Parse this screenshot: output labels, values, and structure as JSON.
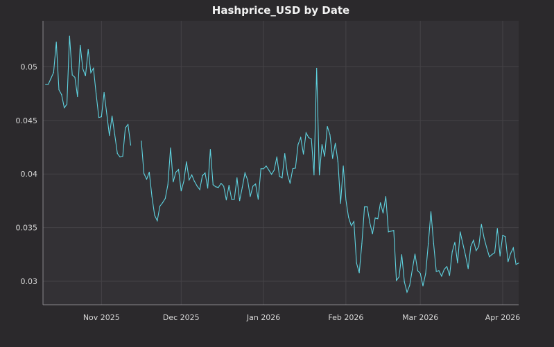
{
  "chart_data": {
    "type": "line",
    "title": "Hashprice_USD by Date",
    "xlabel": "",
    "ylabel": "",
    "xlim": [
      "2025-10-10",
      "2026-04-07"
    ],
    "ylim": [
      0.0278,
      0.0543
    ],
    "grid": true,
    "line_color": "#5fd3e0",
    "x_ticks": [
      {
        "date": "2025-11-01",
        "label": "Nov 2025"
      },
      {
        "date": "2025-12-01",
        "label": "Dec 2025"
      },
      {
        "date": "2026-01-01",
        "label": "Jan 2026"
      },
      {
        "date": "2026-02-01",
        "label": "Feb 2026"
      },
      {
        "date": "2026-03-01",
        "label": "Mar 2026"
      },
      {
        "date": "2026-04-01",
        "label": "Apr 2026"
      }
    ],
    "y_ticks": [
      {
        "value": 0.03,
        "label": "0.03"
      },
      {
        "value": 0.035,
        "label": "0.035"
      },
      {
        "value": 0.04,
        "label": "0.04"
      },
      {
        "value": 0.045,
        "label": "0.045"
      },
      {
        "value": 0.05,
        "label": "0.05"
      }
    ],
    "points": [
      [
        "2025-10-11",
        0.04838
      ],
      [
        "2025-10-12",
        0.04838
      ],
      [
        "2025-10-13",
        0.04893
      ],
      [
        "2025-10-14",
        0.04948
      ],
      [
        "2025-10-15",
        0.05231
      ],
      [
        "2025-10-16",
        0.04786
      ],
      [
        "2025-10-17",
        0.04741
      ],
      [
        "2025-10-18",
        0.04618
      ],
      [
        "2025-10-19",
        0.04651
      ],
      [
        "2025-10-20",
        0.05287
      ],
      [
        "2025-10-21",
        0.04924
      ],
      [
        "2025-10-22",
        0.04903
      ],
      [
        "2025-10-23",
        0.04722
      ],
      [
        "2025-10-24",
        0.05201
      ],
      [
        "2025-10-25",
        0.04981
      ],
      [
        "2025-10-26",
        0.04916
      ],
      [
        "2025-10-27",
        0.05162
      ],
      [
        "2025-10-28",
        0.04945
      ],
      [
        "2025-10-29",
        0.04987
      ],
      [
        "2025-10-30",
        0.0475
      ],
      [
        "2025-10-31",
        0.04528
      ],
      [
        "2025-11-01",
        0.04534
      ],
      [
        "2025-11-02",
        0.04761
      ],
      [
        "2025-11-03",
        0.0456
      ],
      [
        "2025-11-04",
        0.04359
      ],
      [
        "2025-11-05",
        0.04541
      ],
      [
        "2025-11-06",
        0.04366
      ],
      [
        "2025-11-07",
        0.04191
      ],
      [
        "2025-11-08",
        0.04159
      ],
      [
        "2025-11-09",
        0.04165
      ],
      [
        "2025-11-10",
        0.04431
      ],
      [
        "2025-11-11",
        0.04463
      ],
      [
        "2025-11-12",
        0.04269
      ],
      [
        "2025-11-13",
        null
      ],
      [
        "2025-11-14",
        null
      ],
      [
        "2025-11-15",
        null
      ],
      [
        "2025-11-16",
        0.04308
      ],
      [
        "2025-11-17",
        0.04004
      ],
      [
        "2025-11-18",
        0.03952
      ],
      [
        "2025-11-19",
        0.04017
      ],
      [
        "2025-11-20",
        0.0379
      ],
      [
        "2025-11-21",
        0.03615
      ],
      [
        "2025-11-22",
        0.03564
      ],
      [
        "2025-11-23",
        0.037
      ],
      [
        "2025-11-24",
        0.03732
      ],
      [
        "2025-11-25",
        0.03771
      ],
      [
        "2025-11-26",
        0.039
      ],
      [
        "2025-11-27",
        0.04243
      ],
      [
        "2025-11-28",
        0.03926
      ],
      [
        "2025-11-29",
        0.04017
      ],
      [
        "2025-11-30",
        0.04042
      ],
      [
        "2025-12-01",
        0.03842
      ],
      [
        "2025-12-02",
        0.03932
      ],
      [
        "2025-12-03",
        0.04114
      ],
      [
        "2025-12-04",
        0.03945
      ],
      [
        "2025-12-05",
        0.03991
      ],
      [
        "2025-12-06",
        0.03932
      ],
      [
        "2025-12-07",
        0.03887
      ],
      [
        "2025-12-08",
        0.03855
      ],
      [
        "2025-12-09",
        0.03984
      ],
      [
        "2025-12-10",
        0.0401
      ],
      [
        "2025-12-11",
        0.03868
      ],
      [
        "2025-12-12",
        0.0423
      ],
      [
        "2025-12-13",
        0.039
      ],
      [
        "2025-12-14",
        0.03881
      ],
      [
        "2025-12-15",
        0.03874
      ],
      [
        "2025-12-16",
        0.03913
      ],
      [
        "2025-12-17",
        0.03887
      ],
      [
        "2025-12-18",
        0.03758
      ],
      [
        "2025-12-19",
        0.03894
      ],
      [
        "2025-12-20",
        0.03764
      ],
      [
        "2025-12-21",
        0.03764
      ],
      [
        "2025-12-22",
        0.03965
      ],
      [
        "2025-12-23",
        0.03751
      ],
      [
        "2025-12-24",
        0.03874
      ],
      [
        "2025-12-25",
        0.0401
      ],
      [
        "2025-12-26",
        0.03945
      ],
      [
        "2025-12-27",
        0.0379
      ],
      [
        "2025-12-28",
        0.03887
      ],
      [
        "2025-12-29",
        0.03907
      ],
      [
        "2025-12-30",
        0.03764
      ],
      [
        "2025-12-31",
        0.04049
      ],
      [
        "2026-01-01",
        0.04049
      ],
      [
        "2026-01-02",
        0.04075
      ],
      [
        "2026-01-03",
        0.04036
      ],
      [
        "2026-01-04",
        0.03997
      ],
      [
        "2026-01-05",
        0.04036
      ],
      [
        "2026-01-06",
        0.04159
      ],
      [
        "2026-01-07",
        0.03978
      ],
      [
        "2026-01-08",
        0.03965
      ],
      [
        "2026-01-09",
        0.04191
      ],
      [
        "2026-01-10",
        0.03997
      ],
      [
        "2026-01-11",
        0.03913
      ],
      [
        "2026-01-12",
        0.04049
      ],
      [
        "2026-01-13",
        0.04055
      ],
      [
        "2026-01-14",
        0.04275
      ],
      [
        "2026-01-15",
        0.0434
      ],
      [
        "2026-01-16",
        0.04185
      ],
      [
        "2026-01-17",
        0.04385
      ],
      [
        "2026-01-18",
        0.0434
      ],
      [
        "2026-01-19",
        0.04327
      ],
      [
        "2026-01-20",
        0.03991
      ],
      [
        "2026-01-21",
        0.04987
      ],
      [
        "2026-01-22",
        0.03991
      ],
      [
        "2026-01-23",
        0.04275
      ],
      [
        "2026-01-24",
        0.04165
      ],
      [
        "2026-01-25",
        0.04444
      ],
      [
        "2026-01-26",
        0.04366
      ],
      [
        "2026-01-27",
        0.04146
      ],
      [
        "2026-01-28",
        0.04288
      ],
      [
        "2026-01-29",
        0.04114
      ],
      [
        "2026-01-30",
        0.03725
      ],
      [
        "2026-01-31",
        0.04075
      ],
      [
        "2026-02-01",
        0.03758
      ],
      [
        "2026-02-02",
        0.03596
      ],
      [
        "2026-02-03",
        0.03518
      ],
      [
        "2026-02-04",
        0.03557
      ],
      [
        "2026-02-05",
        0.03169
      ],
      [
        "2026-02-06",
        0.03078
      ],
      [
        "2026-02-07",
        0.0335
      ],
      [
        "2026-02-08",
        0.03693
      ],
      [
        "2026-02-09",
        0.03693
      ],
      [
        "2026-02-10",
        0.03544
      ],
      [
        "2026-02-11",
        0.03441
      ],
      [
        "2026-02-12",
        0.0359
      ],
      [
        "2026-02-13",
        0.03583
      ],
      [
        "2026-02-14",
        0.03732
      ],
      [
        "2026-02-15",
        0.03635
      ],
      [
        "2026-02-16",
        0.0379
      ],
      [
        "2026-02-17",
        0.0346
      ],
      [
        "2026-02-18",
        0.03467
      ],
      [
        "2026-02-19",
        0.03473
      ],
      [
        "2026-02-20",
        0.03007
      ],
      [
        "2026-02-21",
        0.0304
      ],
      [
        "2026-02-22",
        0.03247
      ],
      [
        "2026-02-23",
        0.02994
      ],
      [
        "2026-02-24",
        0.02897
      ],
      [
        "2026-02-25",
        0.02962
      ],
      [
        "2026-02-26",
        0.0311
      ],
      [
        "2026-02-27",
        0.03253
      ],
      [
        "2026-02-28",
        0.03098
      ],
      [
        "2026-03-01",
        0.03072
      ],
      [
        "2026-03-02",
        0.02955
      ],
      [
        "2026-03-03",
        0.03072
      ],
      [
        "2026-03-04",
        0.0335
      ],
      [
        "2026-03-05",
        0.03648
      ],
      [
        "2026-03-06",
        0.0335
      ],
      [
        "2026-03-07",
        0.03091
      ],
      [
        "2026-03-08",
        0.03098
      ],
      [
        "2026-03-09",
        0.03046
      ],
      [
        "2026-03-10",
        0.03111
      ],
      [
        "2026-03-11",
        0.03137
      ],
      [
        "2026-03-12",
        0.03053
      ],
      [
        "2026-03-13",
        0.03273
      ],
      [
        "2026-03-14",
        0.03363
      ],
      [
        "2026-03-15",
        0.03169
      ],
      [
        "2026-03-16",
        0.0346
      ],
      [
        "2026-03-17",
        0.0335
      ],
      [
        "2026-03-18",
        0.0324
      ],
      [
        "2026-03-19",
        0.03117
      ],
      [
        "2026-03-20",
        0.03324
      ],
      [
        "2026-03-21",
        0.03382
      ],
      [
        "2026-03-22",
        0.03285
      ],
      [
        "2026-03-23",
        0.03324
      ],
      [
        "2026-03-24",
        0.03531
      ],
      [
        "2026-03-25",
        0.03402
      ],
      [
        "2026-03-26",
        0.0331
      ],
      [
        "2026-03-27",
        0.03227
      ],
      [
        "2026-03-28",
        0.0325
      ],
      [
        "2026-03-29",
        0.03266
      ],
      [
        "2026-03-30",
        0.03492
      ],
      [
        "2026-03-31",
        0.03234
      ],
      [
        "2026-04-01",
        0.03428
      ],
      [
        "2026-04-02",
        0.03415
      ],
      [
        "2026-04-03",
        0.03182
      ],
      [
        "2026-04-04",
        0.0326
      ],
      [
        "2026-04-05",
        0.03311
      ],
      [
        "2026-04-06",
        0.03156
      ],
      [
        "2026-04-07",
        0.03169
      ]
    ]
  }
}
